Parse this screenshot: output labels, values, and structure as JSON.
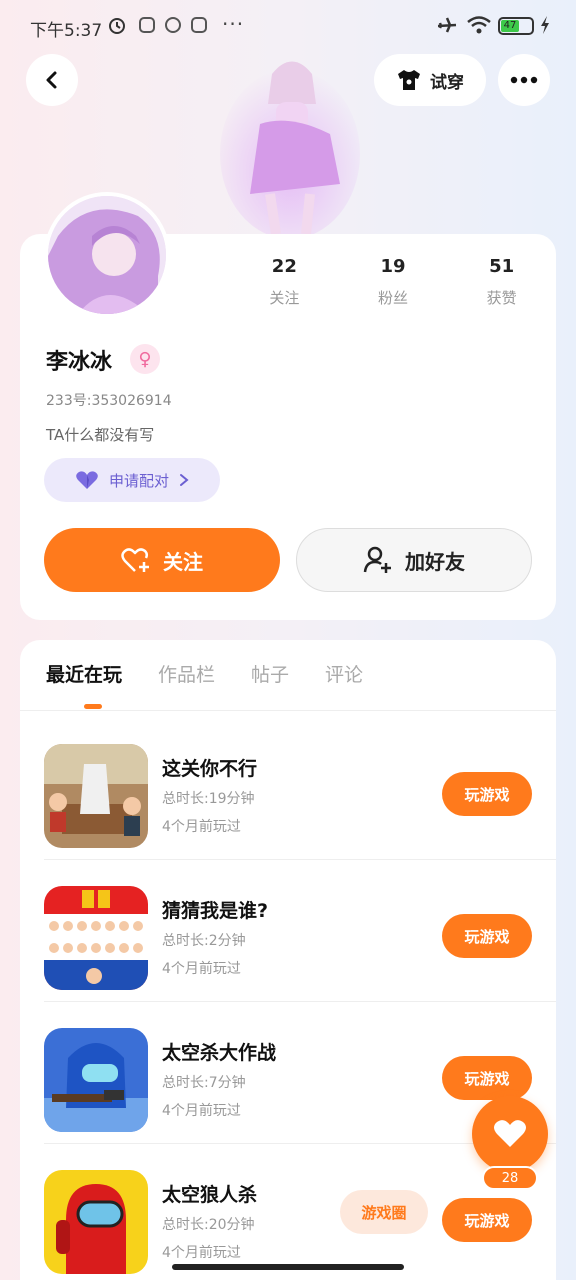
{
  "status_bar": {
    "time": "下午5:37",
    "more": "···",
    "battery": "47"
  },
  "header": {
    "dress_label": "试穿"
  },
  "profile": {
    "stats": [
      {
        "num": "22",
        "label": "关注"
      },
      {
        "num": "19",
        "label": "粉丝"
      },
      {
        "num": "51",
        "label": "获赞"
      }
    ],
    "username": "李冰冰",
    "gender_icon": "♀",
    "user_id": "233号:353026914",
    "bio": "TA什么都没有写",
    "pair_label": "申请配对",
    "follow_label": "关注",
    "friend_label": "加好友"
  },
  "tabs": [
    {
      "label": "最近在玩",
      "active": true
    },
    {
      "label": "作品栏",
      "active": false
    },
    {
      "label": "帖子",
      "active": false
    },
    {
      "label": "评论",
      "active": false
    }
  ],
  "games": [
    {
      "name": "这关你不行",
      "duration": "总时长:19分钟",
      "last_played": "4个月前玩过",
      "play_label": "玩游戏"
    },
    {
      "name": "猜猜我是谁?",
      "duration": "总时长:2分钟",
      "last_played": "4个月前玩过",
      "play_label": "玩游戏"
    },
    {
      "name": "太空杀大作战",
      "duration": "总时长:7分钟",
      "last_played": "4个月前玩过",
      "play_label": "玩游戏"
    },
    {
      "name": "太空狼人杀",
      "duration": "总时长:20分钟",
      "last_played": "4个月前玩过",
      "play_label": "玩游戏"
    }
  ],
  "circle_label": "游戏圈",
  "like_count": "28",
  "colors": {
    "accent": "#ff7a1c",
    "pair_bg": "#ece9fb",
    "pair_text": "#6b5fd1"
  }
}
